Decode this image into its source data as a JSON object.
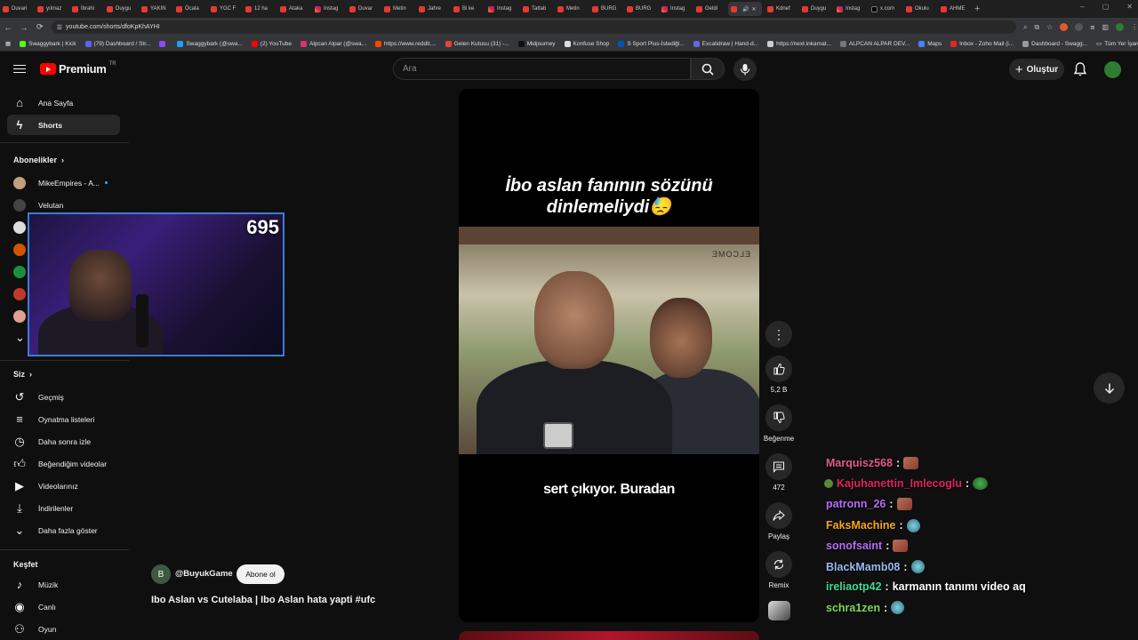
{
  "browser": {
    "tabs": [
      {
        "label": "Duvari",
        "icon": "youtube"
      },
      {
        "label": "yılmaz",
        "icon": "youtube"
      },
      {
        "label": "İbrahi",
        "icon": "youtube"
      },
      {
        "label": "Duygu",
        "icon": "youtube"
      },
      {
        "label": "YAKIN",
        "icon": "youtube"
      },
      {
        "label": "Öcala",
        "icon": "youtube"
      },
      {
        "label": "YGC F",
        "icon": "youtube"
      },
      {
        "label": "12 ha",
        "icon": "youtube"
      },
      {
        "label": "Ataka",
        "icon": "youtube"
      },
      {
        "label": "Instag",
        "icon": "instagram"
      },
      {
        "label": "Duvar",
        "icon": "youtube"
      },
      {
        "label": "Metin",
        "icon": "youtube"
      },
      {
        "label": "Jahre",
        "icon": "youtube"
      },
      {
        "label": "Bi ke",
        "icon": "youtube"
      },
      {
        "label": "Instag",
        "icon": "instagram"
      },
      {
        "label": "Tattab",
        "icon": "youtube"
      },
      {
        "label": "Metin",
        "icon": "youtube"
      },
      {
        "label": "BURG",
        "icon": "youtube"
      },
      {
        "label": "BURG",
        "icon": "youtube"
      },
      {
        "label": "Instag",
        "icon": "instagram"
      },
      {
        "label": "Geldi",
        "icon": "youtube"
      },
      {
        "label": "",
        "icon": "youtube",
        "active": true
      },
      {
        "label": "Kdnef",
        "icon": "youtube"
      },
      {
        "label": "Duygu",
        "icon": "youtube"
      },
      {
        "label": "Instag",
        "icon": "instagram"
      },
      {
        "label": "x.com",
        "icon": "x"
      },
      {
        "label": "Okulu",
        "icon": "youtube"
      },
      {
        "label": "AHME",
        "icon": "youtube"
      }
    ],
    "url": "youtube.com/shorts/dfoKpKhAYHI",
    "bookmarks": [
      "Swaggybark | Kick",
      "(79) Dashboard / Str...",
      "",
      "Swaggybark (@swa...",
      "(2) YouTube",
      "Alpcan Alpar (@swa...",
      "https://www.reddit....",
      "Gelen Kutusu (31) -...",
      "Midjourney",
      "Konfuse Shop",
      "S Sport Plus-İstediği...",
      "Excalidraw | Hand-d...",
      "https://next.inkamat...",
      "ALPCAN ALPAR DEV...",
      "Maps",
      "Inbox - Zoho Mail (i...",
      "Dashboard - Swagg..."
    ],
    "all_bookmarks": "Tüm Yer İşaretleri"
  },
  "header": {
    "logo_text": "Premium",
    "country_code": "TR",
    "search_placeholder": "Ara",
    "create_label": "Oluştur"
  },
  "sidebar": {
    "main": [
      {
        "label": "Ana Sayfa",
        "icon": "home-icon"
      },
      {
        "label": "Shorts",
        "icon": "shorts-icon",
        "active": true
      }
    ],
    "subscriptions_title": "Abonelikler",
    "subscriptions": [
      {
        "label": "MikeEmpires - A...",
        "live_dot": true
      },
      {
        "label": "Velutan"
      }
    ],
    "you_title": "Siz",
    "you": [
      {
        "label": "Geçmiş",
        "icon": "history-icon"
      },
      {
        "label": "Oynatma listeleri",
        "icon": "playlist-icon"
      },
      {
        "label": "Daha sonra izle",
        "icon": "clock-icon"
      },
      {
        "label": "Beğendiğim videolar",
        "icon": "like-icon"
      },
      {
        "label": "Videolarınız",
        "icon": "video-icon"
      },
      {
        "label": "İndirilenler",
        "icon": "download-icon"
      },
      {
        "label": "Daha fazla göster",
        "icon": "chevron-down-icon"
      }
    ],
    "explore_title": "Keşfet",
    "explore": [
      {
        "label": "Müzik",
        "icon": "music-icon"
      },
      {
        "label": "Canlı",
        "icon": "live-icon"
      },
      {
        "label": "Oyun",
        "icon": "game-icon"
      }
    ]
  },
  "webcam": {
    "viewer_count": "695"
  },
  "short": {
    "overlay_title_line1": "İbo aslan fanının sözünü",
    "overlay_title_line2": "dinlemeliydi😓",
    "subtitle": "sert çıkıyor. Buradan",
    "sign_text": "ELCOME"
  },
  "actions": {
    "likes": "5,2 B",
    "dislike_label": "Beğenme",
    "comments": "472",
    "share_label": "Paylaş",
    "remix_label": "Remix"
  },
  "channel": {
    "initial": "B",
    "name": "@BuyukGame",
    "subscribe_label": "Abone ol",
    "video_title": "Ibo Aslan vs Cutelaba | Ibo Aslan hata yapti #ufc"
  },
  "chat": [
    {
      "user": "Marquisz568",
      "color": "#e05a8a",
      "message": "",
      "emote": "a"
    },
    {
      "user": "Kajuhanettin_Imlecoglu",
      "color": "#e0245e",
      "message": "",
      "emote": "c",
      "badge": true
    },
    {
      "user": "patronn_26",
      "color": "#b56cf5",
      "message": "",
      "emote": "a"
    },
    {
      "user": "FaksMachine",
      "color": "#f5a623",
      "message": "",
      "emote": "b"
    },
    {
      "user": "sonofsaint",
      "color": "#b56cf5",
      "message": "",
      "emote": "a"
    },
    {
      "user": "BlackMamb08",
      "color": "#9ab8f0",
      "message": "",
      "emote": "b"
    },
    {
      "user": "ireliaotp42",
      "color": "#3ddc97",
      "message": "karmanın tanımı video aq",
      "emote": ""
    },
    {
      "user": "schra1zen",
      "color": "#7ed957",
      "message": "",
      "emote": "b"
    }
  ]
}
